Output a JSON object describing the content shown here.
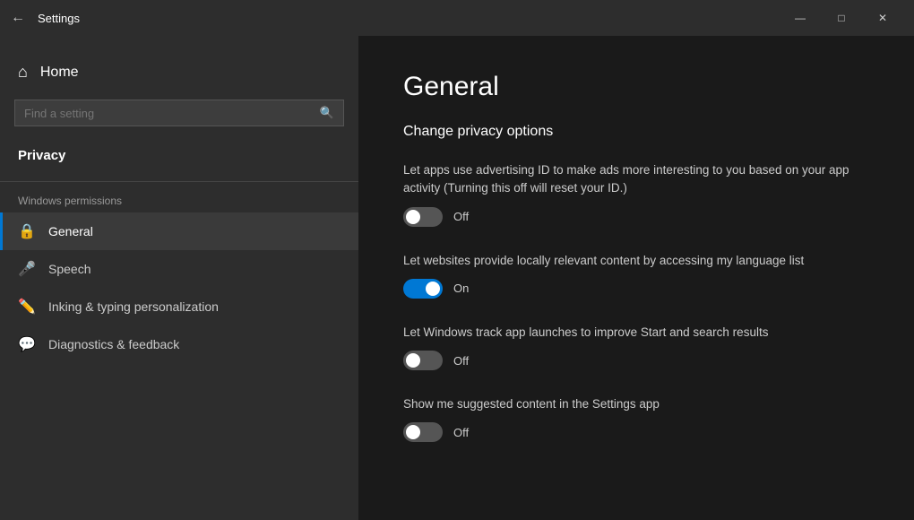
{
  "titlebar": {
    "back_label": "←",
    "title": "Settings",
    "minimize_label": "—",
    "maximize_label": "□",
    "close_label": "✕"
  },
  "sidebar": {
    "home_label": "Home",
    "search_placeholder": "Find a setting",
    "category_label": "Privacy",
    "section_label": "Windows permissions",
    "items": [
      {
        "id": "general",
        "label": "General",
        "icon": "🔒",
        "active": true
      },
      {
        "id": "speech",
        "label": "Speech",
        "icon": "🎤",
        "active": false
      },
      {
        "id": "inking",
        "label": "Inking & typing personalization",
        "icon": "✏️",
        "active": false
      },
      {
        "id": "diagnostics",
        "label": "Diagnostics & feedback",
        "icon": "💬",
        "active": false
      }
    ]
  },
  "main": {
    "page_title": "General",
    "section_title": "Change privacy options",
    "settings": [
      {
        "id": "advertising",
        "description": "Let apps use advertising ID to make ads more interesting to you based on your app activity (Turning this off will reset your ID.)",
        "state": "off",
        "state_label": "Off"
      },
      {
        "id": "language",
        "description": "Let websites provide locally relevant content by accessing my language list",
        "state": "on",
        "state_label": "On"
      },
      {
        "id": "tracking",
        "description": "Let Windows track app launches to improve Start and search results",
        "state": "off",
        "state_label": "Off"
      },
      {
        "id": "suggested",
        "description": "Show me suggested content in the Settings app",
        "state": "off",
        "state_label": "Off"
      }
    ]
  }
}
